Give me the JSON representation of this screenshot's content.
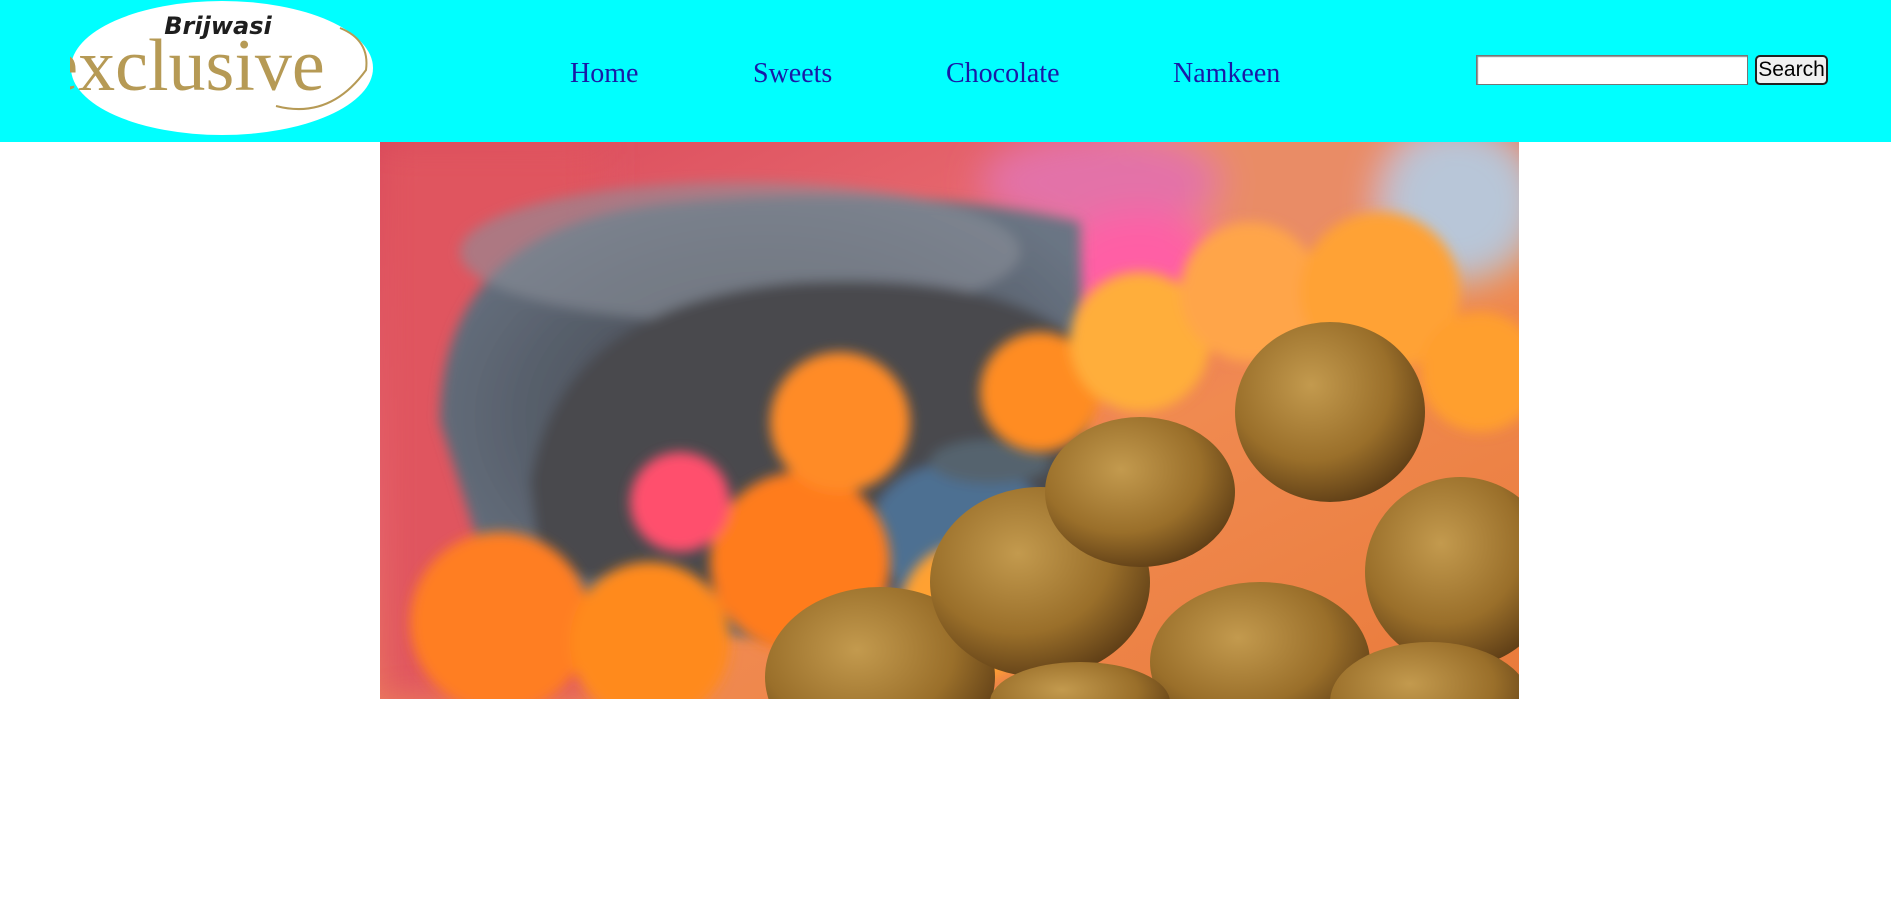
{
  "header": {
    "background_color": "#00ffff",
    "logo": {
      "brand_top": "Brijwasi",
      "brand_main": "exclusive",
      "icon": "brijwasi-exclusive-logo"
    }
  },
  "nav": {
    "items": [
      {
        "label": "Home"
      },
      {
        "label": "Sweets"
      },
      {
        "label": "Chocolate"
      },
      {
        "label": "Namkeen"
      }
    ],
    "link_color": "#1a1aa6"
  },
  "search": {
    "value": "",
    "placeholder": "",
    "button_label": "Search"
  },
  "hero": {
    "image": "laddoo-sweets-with-marigold-flowers"
  }
}
